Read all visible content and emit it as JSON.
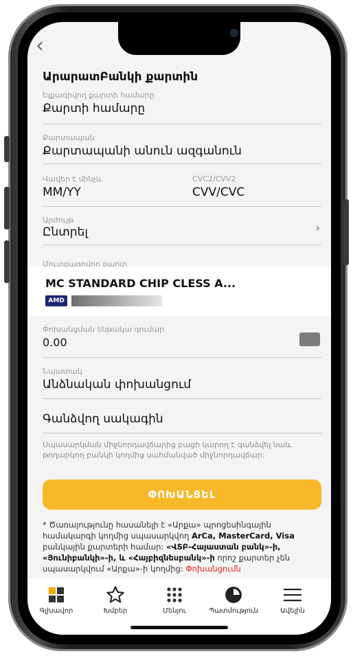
{
  "form": {
    "title": "ԱրարատԲանկի քարտին",
    "card_number": {
      "label": "Ելքագրվող քարտի համարը",
      "placeholder": "Քարտի համարը"
    },
    "holder": {
      "label": "Քարտապան",
      "placeholder": "Քարտապանի անուն ազգանուն"
    },
    "expiry": {
      "label": "Վավեր է մինչև",
      "placeholder": "MM/YY"
    },
    "cvc": {
      "label": "CVC2/CVV2",
      "placeholder": "CVV/CVC"
    },
    "currency": {
      "label": "Արժույթ",
      "value": "Ընտրել"
    },
    "source_card": {
      "label": "Մուտքագրվող քարտ",
      "name": "MC STANDARD CHIP CLESS A...",
      "currency_badge": "AMD"
    },
    "amount": {
      "label": "Փոխանցման ենթակա գումար",
      "value": "0.00"
    },
    "purpose": {
      "label": "Նպատակ",
      "value": "Անձնական փոխանցում"
    },
    "fee": {
      "title": "Գանձվող սակագին",
      "note": "Սպասարկման միջնորդավճարից բացի կարող է գանձվել նաև թողարկող բանկի կողմից սահմանված միջնորդավճար:"
    },
    "transfer_button": "ՓՈԽԱՆՑԵԼ",
    "disclaimer": {
      "p1": "* Ծառայությունը հասանելի է «Արքա» պրոցեսինգային համակարգի կողմից սպասարկվող ",
      "b1": "ArCa, MasterCard, Visa",
      "p2": " բանկային քարտերի համար: ",
      "b2": "«ՎՏԲ-Հայաստան բանկ»-ի, «Յունիբանկի»-ի, և «Հայբիզնեսբանկ»-ի",
      "p3": " որոշ քարտեր չեն սպասարկվում «Արքա»-ի կողմից: ",
      "red": "Փոխանցումն"
    }
  },
  "tabbar": {
    "items": [
      {
        "label": "Գլխավոր",
        "icon": "home-grid-icon"
      },
      {
        "label": "Խմբեր",
        "icon": "star-icon"
      },
      {
        "label": "Մենյու",
        "icon": "dots-grid-icon"
      },
      {
        "label": "Պատմություն",
        "icon": "history-clock-icon"
      },
      {
        "label": "Ավելին",
        "icon": "hamburger-menu-icon"
      }
    ]
  },
  "colors": {
    "accent": "#f7b92a",
    "tab_home": "#f2a900",
    "badge": "#1c2670",
    "link_red": "#e02020"
  }
}
